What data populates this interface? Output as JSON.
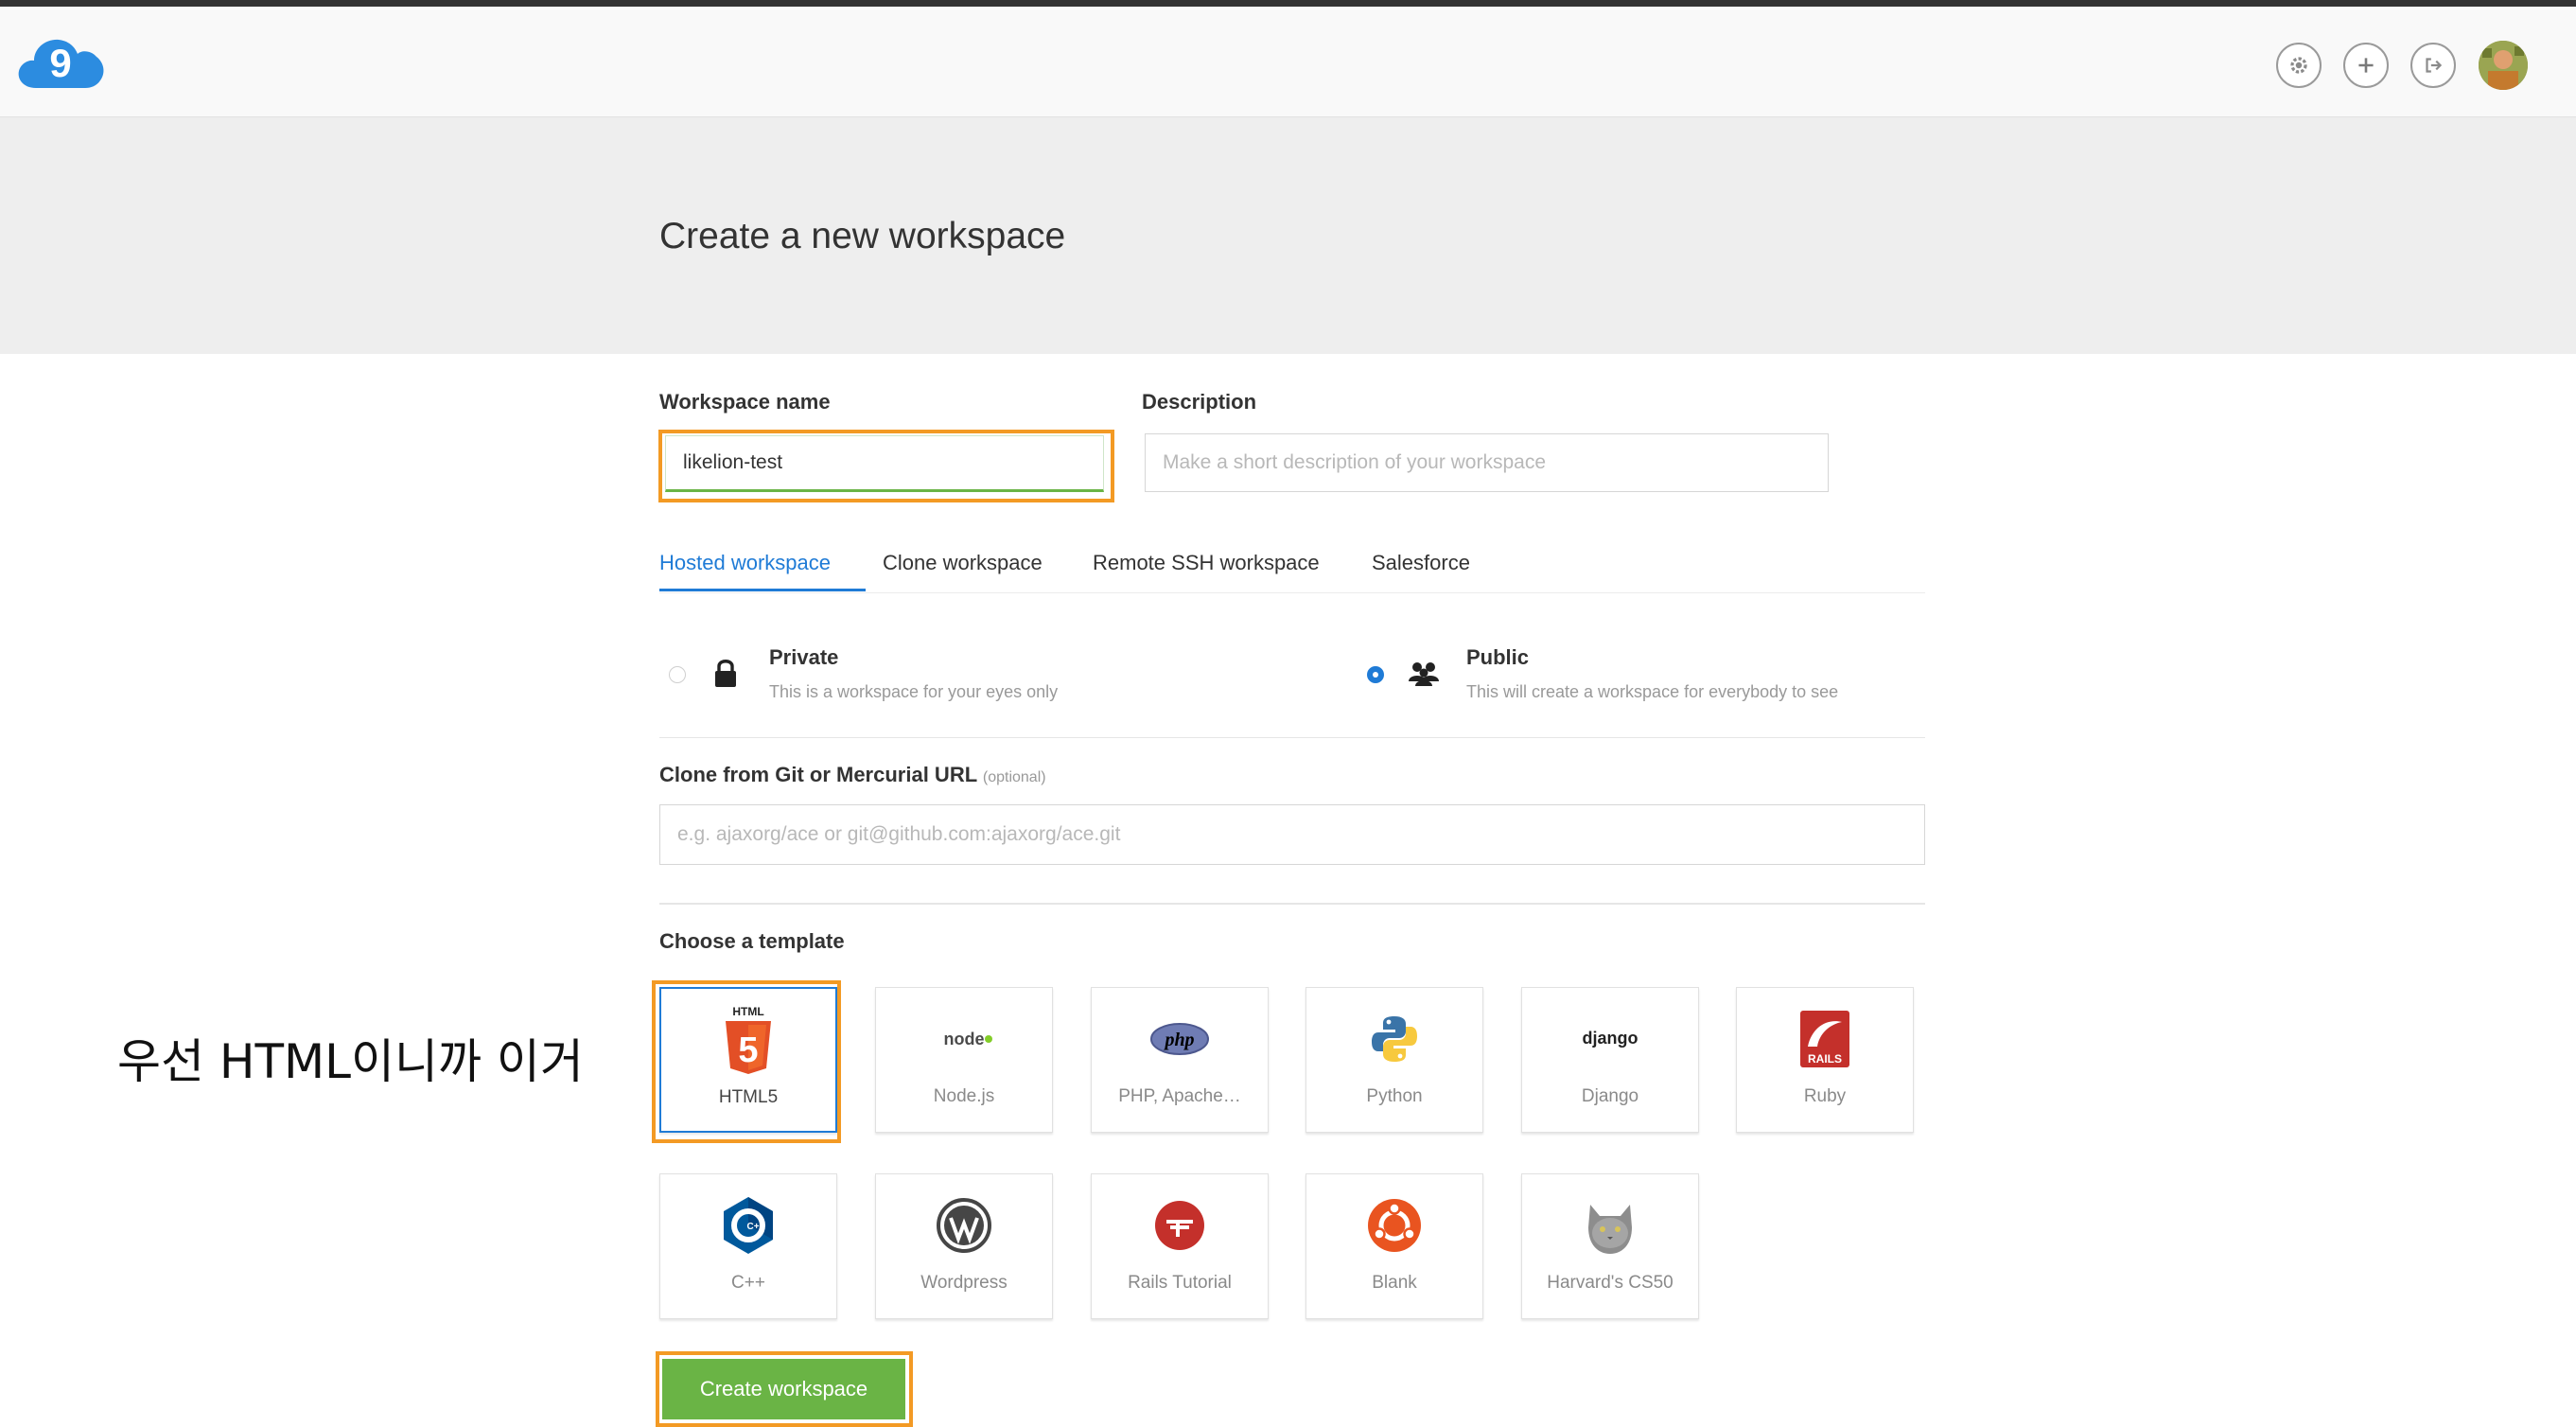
{
  "header": {
    "logo_digit": "9",
    "icons": [
      "gear-icon",
      "plus-icon",
      "logout-icon"
    ]
  },
  "page": {
    "title": "Create a new workspace"
  },
  "form": {
    "workspace_name_label": "Workspace name",
    "workspace_name_value": "likelion-test",
    "description_label": "Description",
    "description_placeholder": "Make a short description of your workspace"
  },
  "tabs": [
    {
      "label": "Hosted workspace",
      "active": true
    },
    {
      "label": "Clone workspace",
      "active": false
    },
    {
      "label": "Remote SSH workspace",
      "active": false
    },
    {
      "label": "Salesforce",
      "active": false
    }
  ],
  "visibility": {
    "private": {
      "title": "Private",
      "desc": "This is a workspace for your eyes only",
      "checked": false
    },
    "public": {
      "title": "Public",
      "desc": "This will create a workspace for everybody to see",
      "checked": true
    }
  },
  "clone": {
    "label": "Clone from Git or Mercurial URL",
    "optional_note": "(optional)",
    "placeholder": "e.g. ajaxorg/ace or git@github.com:ajaxorg/ace.git"
  },
  "templates": {
    "label": "Choose a template",
    "items": [
      {
        "label": "HTML5",
        "icon": "html5-icon",
        "selected": true
      },
      {
        "label": "Node.js",
        "icon": "nodejs-icon"
      },
      {
        "label": "PHP, Apache…",
        "icon": "php-icon"
      },
      {
        "label": "Python",
        "icon": "python-icon"
      },
      {
        "label": "Django",
        "icon": "django-icon"
      },
      {
        "label": "Ruby",
        "icon": "rails-icon"
      },
      {
        "label": "C++",
        "icon": "cpp-icon"
      },
      {
        "label": "Wordpress",
        "icon": "wordpress-icon"
      },
      {
        "label": "Rails Tutorial",
        "icon": "rails-tutorial-icon"
      },
      {
        "label": "Blank",
        "icon": "ubuntu-icon"
      },
      {
        "label": "Harvard's CS50",
        "icon": "cs50-cat-icon"
      }
    ],
    "icon_text": {
      "html5_top": "HTML",
      "html5_digit": "5",
      "nodejs": "node",
      "php": "php",
      "django": "django",
      "rails": "RAILS",
      "cpp": "C++"
    }
  },
  "actions": {
    "create_label": "Create workspace"
  },
  "annotation": "우선 HTML이니까 이거",
  "colors": {
    "accent_blue": "#1f7bd6",
    "highlight_orange": "#f39a24",
    "create_green": "#6ab445",
    "logo_blue": "#2c8ce0"
  }
}
